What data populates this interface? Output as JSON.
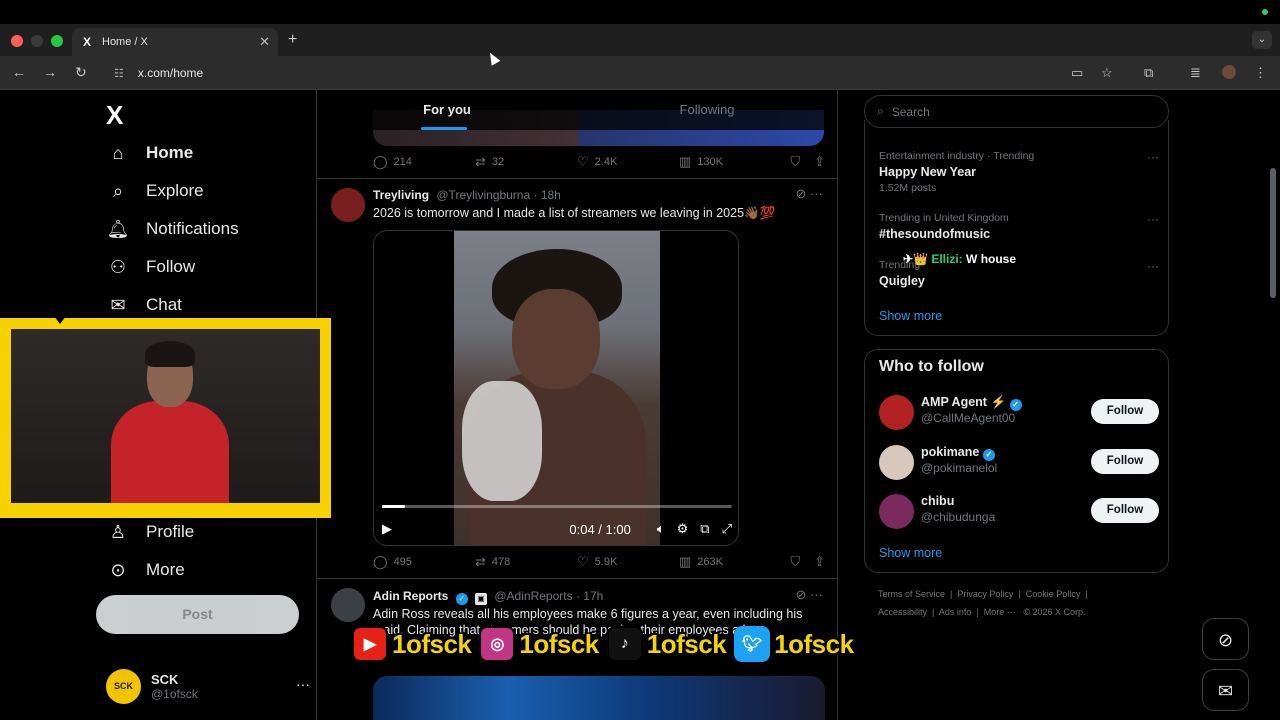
{
  "browser": {
    "tab_title": "Home / X",
    "tab_favicon": "X",
    "new_tab": "+",
    "address": "x.com/home",
    "traffic_lights": [
      "#ff5f57",
      "#3a3a3a",
      "#28c840"
    ]
  },
  "sidebar": {
    "logo": "X",
    "items": [
      {
        "label": "Home",
        "icon": "home-icon"
      },
      {
        "label": "Explore",
        "icon": "search-icon"
      },
      {
        "label": "Notifications",
        "icon": "bell-icon"
      },
      {
        "label": "Follow",
        "icon": "person-add-icon"
      },
      {
        "label": "Chat",
        "icon": "mail-icon"
      },
      {
        "label": "Profile",
        "icon": "person-icon"
      },
      {
        "label": "More",
        "icon": "more-circle-icon"
      }
    ],
    "post_label": "Post",
    "account": {
      "name": "SCK",
      "handle": "@1ofsck",
      "avatar_text": "SCK"
    }
  },
  "feed": {
    "tabs": [
      "For you",
      "Following"
    ],
    "first_actions": {
      "replies": "214",
      "reposts": "32",
      "likes": "2.4K",
      "views": "130K"
    },
    "tweet1": {
      "name": "Treyliving",
      "handle": "@Treylivingburna",
      "time": "· 18h",
      "text": "2026 is tomorrow and I made a list of streamers we leaving in 2025👋🏾💯",
      "video_time": "0:04 / 1:00",
      "video_progress": 0.067,
      "actions": {
        "replies": "495",
        "reposts": "478",
        "likes": "5.9K",
        "views": "263K"
      }
    },
    "tweet2": {
      "name": "Adin Reports",
      "handle": "@AdinReports",
      "time": "· 17h",
      "text": "Adin Ross reveals all his employees make 6 figures a year, even including his maid. Claiming that streamers should be paying their employees a lot..."
    }
  },
  "right": {
    "search_placeholder": "Search",
    "trends": [
      {
        "category": "Entertainment industry · Trending",
        "title": "Happy New Year",
        "count": "1.52M posts"
      },
      {
        "category": "Trending in United Kingdom",
        "title": "#thesoundofmusic",
        "count": ""
      },
      {
        "category": "Trending",
        "title": "Quigley",
        "count": ""
      }
    ],
    "show_more": "Show more",
    "who_to_follow": {
      "title": "Who to follow",
      "users": [
        {
          "name": "AMP Agent ⚡",
          "handle": "@CallMeAgent00",
          "button": "Follow",
          "avatar_color": "#b22222"
        },
        {
          "name": "pokimane",
          "handle": "@pokimanelol",
          "button": "Follow",
          "avatar_color": "#d8c7bb"
        },
        {
          "name": "chibu",
          "handle": "@chibudunga",
          "button": "Follow",
          "avatar_color": "#7a2a5e"
        }
      ],
      "show_more": "Show more"
    },
    "footer": [
      "Terms of Service",
      "|",
      "Privacy Policy",
      "|",
      "Cookie Policy",
      "|",
      "Accessibility",
      "|",
      "Ads info",
      "|",
      "More ···",
      "© 2026 X Corp."
    ]
  },
  "overlay": {
    "chat_name": "Ellizi:",
    "chat_msg": "W house",
    "socials": [
      {
        "platform": "youtube-icon",
        "handle": "1ofsck",
        "color": "#e62117"
      },
      {
        "platform": "instagram-icon",
        "handle": "1ofsck",
        "color": "#c13584"
      },
      {
        "platform": "tiktok-icon",
        "handle": "1ofsck",
        "color": "#111111"
      },
      {
        "platform": "twitter-icon",
        "handle": "1ofsck",
        "color": "#1da1f2"
      }
    ]
  }
}
